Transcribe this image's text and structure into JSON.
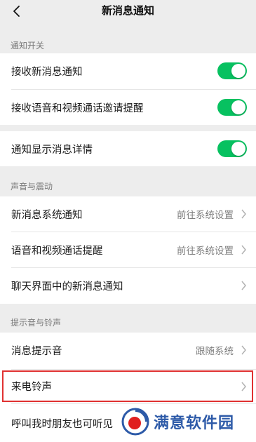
{
  "navbar": {
    "title": "新消息通知"
  },
  "sections": {
    "notify_switch": "通知开关",
    "sound_vibration": "声音与震动",
    "tone_ringtone": "提示音与铃声"
  },
  "rows": {
    "receive_new_messages": {
      "label": "接收新消息通知",
      "toggle_on": true
    },
    "receive_call_invites": {
      "label": "接收语音和视频通话邀请提醒",
      "toggle_on": true
    },
    "show_message_details": {
      "label": "通知显示消息详情",
      "toggle_on": true
    },
    "system_notification": {
      "label": "新消息系统通知",
      "value": "前往系统设置"
    },
    "call_reminder": {
      "label": "语音和视频通话提醒",
      "value": "前往系统设置"
    },
    "in_chat_notification": {
      "label": "聊天界面中的新消息通知"
    },
    "message_tone": {
      "label": "消息提示音",
      "value": "跟随系统"
    },
    "incoming_ringtone": {
      "label": "来电铃声"
    },
    "friend_call_hear": {
      "label": "呼叫我时朋友也可听见"
    }
  },
  "colors": {
    "toggle_on": "#07c160",
    "highlight": "#e03131",
    "background": "#ededed"
  },
  "icons": {
    "back": "chevron-left-icon",
    "disclosure": "chevron-right-icon"
  },
  "watermark": {
    "text": "满意软件园"
  }
}
